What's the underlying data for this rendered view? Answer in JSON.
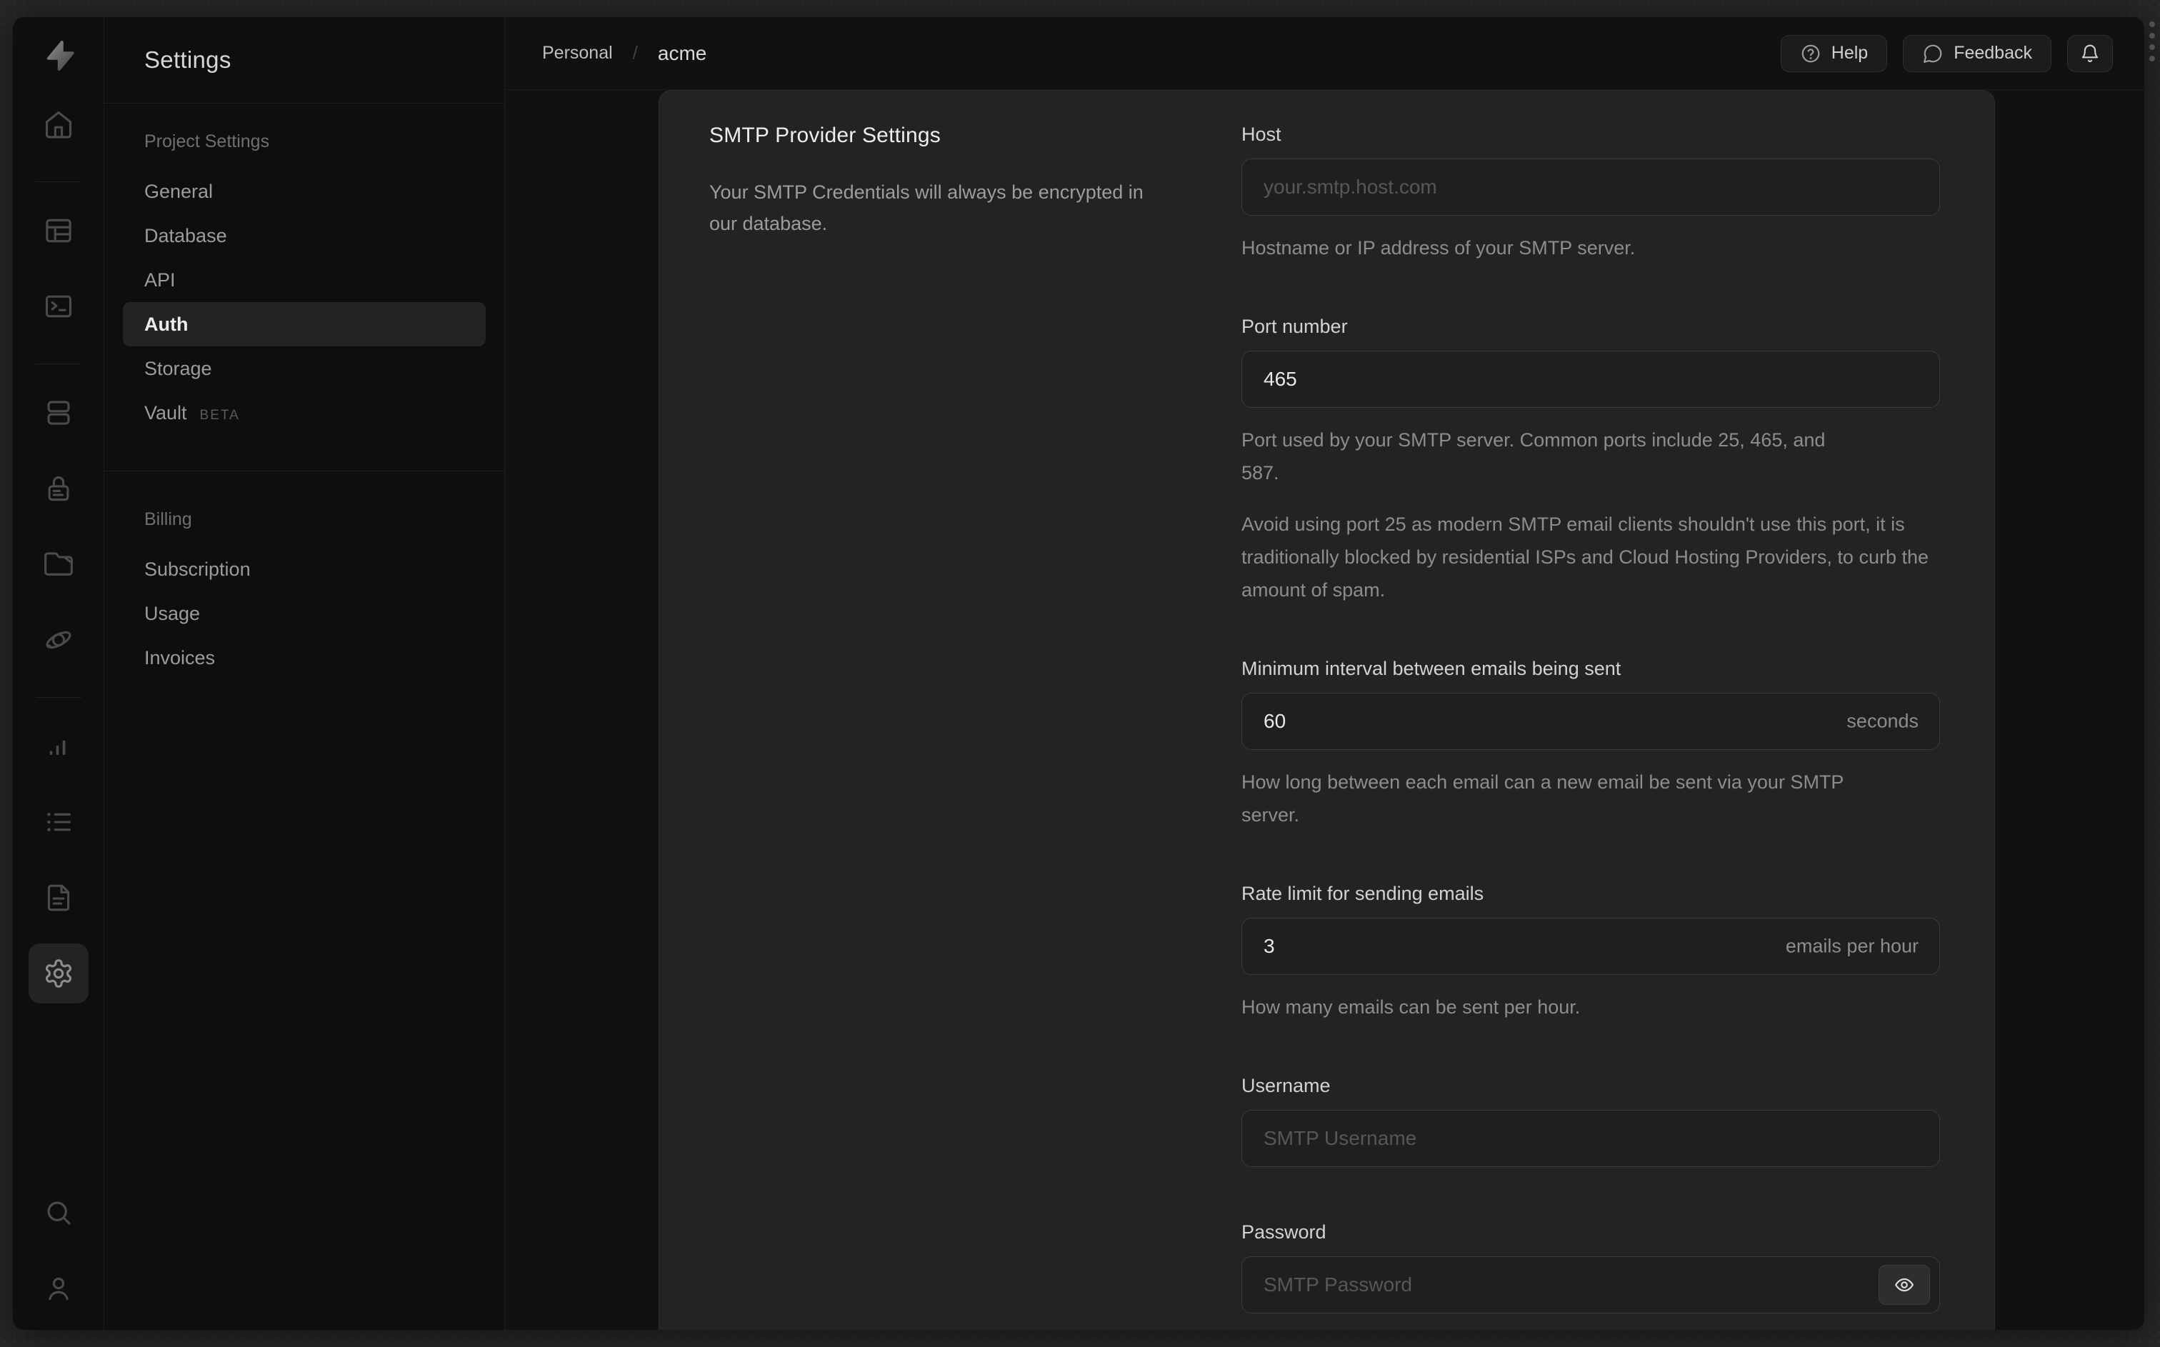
{
  "colors": {
    "backdrop": "#272727",
    "window_bg": "#111111",
    "rail_bg": "#0e0e0e",
    "panel_bg": "#232324",
    "input_bg": "#1f1f20",
    "active_item_bg": "#232323",
    "text_primary": "#ededed",
    "text_muted": "#8d8d8d"
  },
  "rail": {
    "items": [
      {
        "name": "supabase-logo"
      },
      {
        "name": "home"
      },
      {
        "name": "table-editor"
      },
      {
        "name": "sql-editor"
      },
      {
        "name": "database"
      },
      {
        "name": "authentication"
      },
      {
        "name": "storage"
      },
      {
        "name": "edge-functions"
      },
      {
        "name": "reports"
      },
      {
        "name": "logs"
      },
      {
        "name": "docs"
      },
      {
        "name": "project-settings",
        "active": true
      },
      {
        "name": "search"
      },
      {
        "name": "account"
      }
    ]
  },
  "sidebar": {
    "title": "Settings",
    "sections": [
      {
        "header": "Project Settings",
        "items": [
          {
            "label": "General"
          },
          {
            "label": "Database"
          },
          {
            "label": "API"
          },
          {
            "label": "Auth",
            "active": true
          },
          {
            "label": "Storage"
          },
          {
            "label": "Vault",
            "badge": "BETA"
          }
        ]
      },
      {
        "header": "Billing",
        "items": [
          {
            "label": "Subscription"
          },
          {
            "label": "Usage"
          },
          {
            "label": "Invoices"
          }
        ]
      }
    ]
  },
  "topbar": {
    "breadcrumb": {
      "org": "Personal",
      "separator": "/",
      "project": "acme"
    },
    "help_label": "Help",
    "feedback_label": "Feedback"
  },
  "panel": {
    "title": "SMTP Provider Settings",
    "description": "Your SMTP Credentials will always be encrypted in our database.",
    "fields": [
      {
        "label": "Host",
        "placeholder": "your.smtp.host.com",
        "helper": "Hostname or IP address of your SMTP server."
      },
      {
        "label": "Port number",
        "value": "465",
        "helper": "Port used by your SMTP server. Common ports include 25, 465, and 587.",
        "note": "Avoid using port 25 as modern SMTP email clients shouldn't use this port, it is traditionally blocked by residential ISPs and Cloud Hosting Providers, to curb the amount of spam."
      },
      {
        "label": "Minimum interval between emails being sent",
        "value": "60",
        "suffix": "seconds",
        "helper": "How long between each email can a new email be sent via your SMTP server."
      },
      {
        "label": "Rate limit for sending emails",
        "value": "3",
        "suffix": "emails per hour",
        "helper": "How many emails can be sent per hour."
      },
      {
        "label": "Username",
        "placeholder": "SMTP Username"
      },
      {
        "label": "Password",
        "placeholder": "SMTP Password"
      }
    ]
  }
}
